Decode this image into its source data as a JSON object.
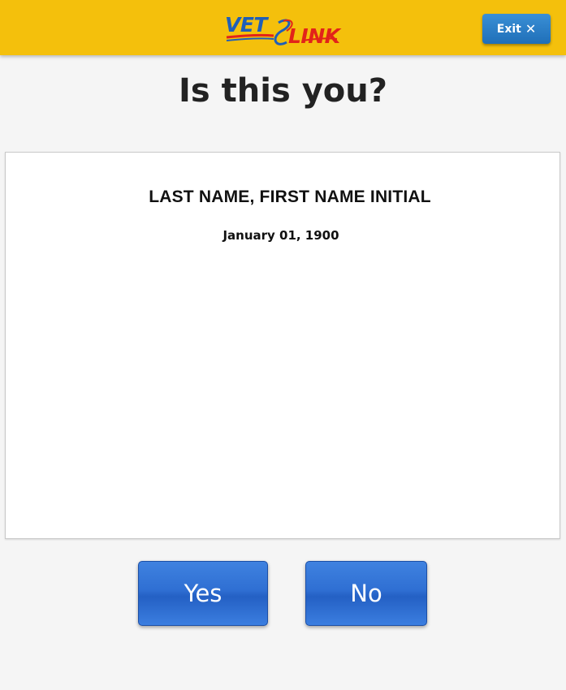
{
  "header": {
    "logo": {
      "part1": "VET",
      "part2": "LINK",
      "colors": {
        "blue": "#1f5fb8",
        "red": "#e2231a"
      }
    },
    "exit_label": "Exit",
    "exit_icon": "close-icon",
    "background_color": "#f4c00c"
  },
  "title": "Is this you?",
  "card": {
    "name": "LAST NAME, FIRST NAME INITIAL",
    "date": "January 01, 1900"
  },
  "actions": {
    "yes_label": "Yes",
    "no_label": "No",
    "button_color": "#2f6fd3"
  }
}
